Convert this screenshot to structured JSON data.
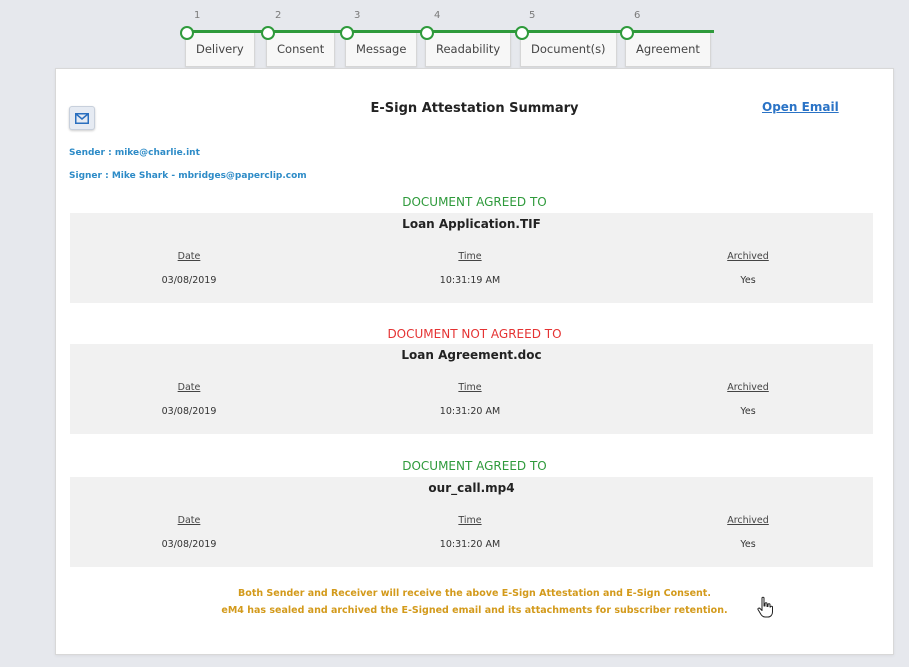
{
  "stepper": {
    "steps": [
      {
        "num": "1",
        "label": "Delivery"
      },
      {
        "num": "2",
        "label": "Consent"
      },
      {
        "num": "3",
        "label": "Message"
      },
      {
        "num": "4",
        "label": "Readability"
      },
      {
        "num": "5",
        "label": "Document(s)"
      },
      {
        "num": "6",
        "label": "Agreement"
      }
    ],
    "accent_color": "#2e9a3b"
  },
  "summary": {
    "title": "E-Sign Attestation Summary",
    "open_email": "Open Email",
    "sender": "Sender : mike@charlie.int",
    "signer": "Signer : Mike Shark - mbridges@paperclip.com",
    "column_headers": {
      "date": "Date",
      "time": "Time",
      "archived": "Archived"
    },
    "documents": [
      {
        "status": "DOCUMENT AGREED TO",
        "name": "Loan Application.TIF",
        "date": "03/08/2019",
        "time": "10:31:19 AM",
        "archived": "Yes"
      },
      {
        "status": "DOCUMENT NOT AGREED TO",
        "name": "Loan Agreement.doc",
        "date": "03/08/2019",
        "time": "10:31:20 AM",
        "archived": "Yes"
      },
      {
        "status": "DOCUMENT AGREED TO",
        "name": "our_call.mp4",
        "date": "03/08/2019",
        "time": "10:31:20 AM",
        "archived": "Yes"
      }
    ],
    "footer_line1": "Both Sender and Receiver will receive the above E-Sign Attestation and E-Sign Consent.",
    "footer_line2": "eM4 has sealed and archived the E-Signed email and its attachments for subscriber retention."
  },
  "colors": {
    "agreed": "#2e9a3b",
    "not_agreed": "#e53333",
    "link": "#2a73c6",
    "footer": "#d39a1b"
  },
  "icons": {
    "mail": "envelope-icon",
    "cursor": "hand-pointer-icon"
  }
}
